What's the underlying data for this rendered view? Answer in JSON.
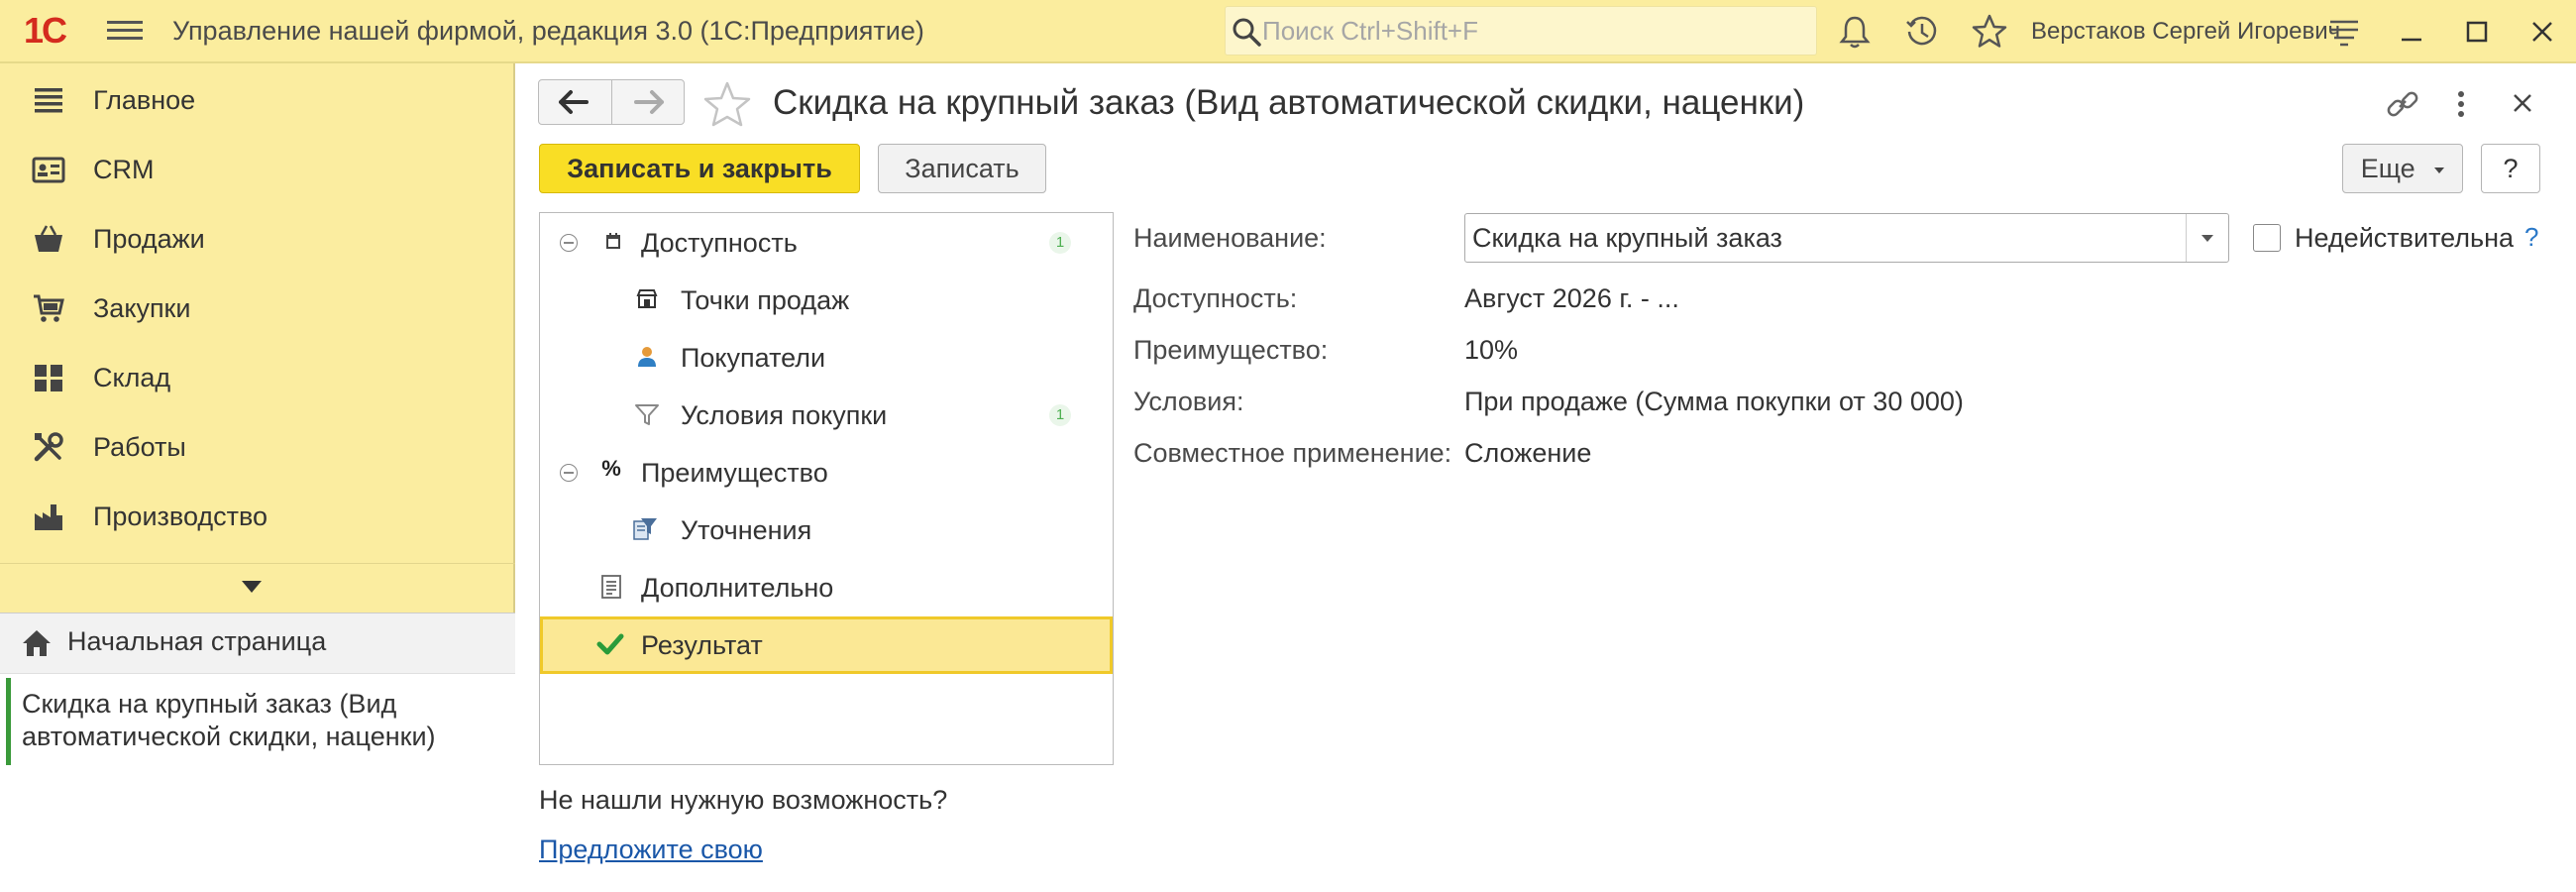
{
  "titlebar": {
    "logo": "1С",
    "app_title": "Управление нашей фирмой, редакция 3.0  (1С:Предприятие)",
    "search_placeholder": "Поиск Ctrl+Shift+F",
    "user_name": "Верстаков Сергей Игоревич"
  },
  "sidebar": {
    "items": [
      {
        "label": "Главное",
        "icon": "list-icon"
      },
      {
        "label": "CRM",
        "icon": "contact-card-icon"
      },
      {
        "label": "Продажи",
        "icon": "basket-icon"
      },
      {
        "label": "Закупки",
        "icon": "cart-icon"
      },
      {
        "label": "Склад",
        "icon": "warehouse-icon"
      },
      {
        "label": "Работы",
        "icon": "tools-icon"
      },
      {
        "label": "Производство",
        "icon": "factory-icon"
      }
    ],
    "home_label": "Начальная страница",
    "open_window_label": "Скидка на крупный заказ (Вид автоматической скидки, наценки)"
  },
  "form": {
    "title": "Скидка на крупный заказ (Вид автоматической скидки, наценки)",
    "save_close_label": "Записать и закрыть",
    "save_label": "Записать",
    "more_label": "Еще",
    "help_label": "?"
  },
  "tree": [
    {
      "label": "Доступность",
      "count": "1"
    },
    {
      "label": "Точки продаж"
    },
    {
      "label": "Покупатели"
    },
    {
      "label": "Условия покупки",
      "count": "1"
    },
    {
      "label": "Преимущество"
    },
    {
      "label": "Уточнения"
    },
    {
      "label": "Дополнительно"
    },
    {
      "label": "Результат"
    }
  ],
  "hint": {
    "text": "Не нашли нужную возможность?",
    "link": "Предложите свою"
  },
  "fields": {
    "name_label": "Наименование:",
    "name_value": "Скидка на крупный заказ",
    "inactive_label": "Недействительна",
    "help_mark": "?",
    "availability_label": "Доступность:",
    "availability_value": "Август 2026 г. - ...",
    "advantage_label": "Преимущество:",
    "advantage_value": "10%",
    "conditions_label": "Условия:",
    "conditions_value": "При продаже (Сумма покупки от 30 000)",
    "joint_label": "Совместное применение:",
    "joint_value": "Сложение"
  },
  "colors": {
    "titlebar_bg": "#fbed9e",
    "sidebar_bg": "#fbeda0",
    "primary_button": "#f9de25",
    "selected_row": "#fbe895",
    "link": "#1a57a8",
    "logo_red": "#d42b1e"
  }
}
